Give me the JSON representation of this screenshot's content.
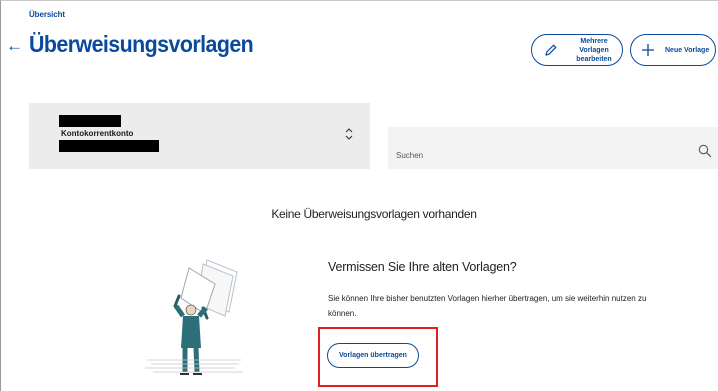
{
  "header": {
    "breadcrumb": "Übersicht",
    "back_icon": "←",
    "title": "Überweisungsvorlagen"
  },
  "toolbar": {
    "edit_multiple_label_line1": "Mehrere Vorlagen",
    "edit_multiple_label_line2": "bearbeiten",
    "new_template_label": "Neue Vorlage",
    "edit_icon": "pencil-icon",
    "new_icon": "plus-icon"
  },
  "account_select": {
    "account_type": "Kontokorrentkonto",
    "icon": "chevron-up-down-icon"
  },
  "search": {
    "placeholder": "Suchen",
    "icon": "search-icon"
  },
  "empty_state": {
    "message": "Keine Überweisungsvorlagen vorhanden"
  },
  "migration": {
    "heading": "Vermissen Sie Ihre alten Vorlagen?",
    "text": "Sie können Ihre bisher benutzten Vorlagen hierher übertragen, um sie weiterhin nutzen zu können.",
    "button_label": "Vorlagen übertragen"
  },
  "colors": {
    "brand_blue": "#0a4a9c",
    "highlight_red": "#e0201f"
  }
}
